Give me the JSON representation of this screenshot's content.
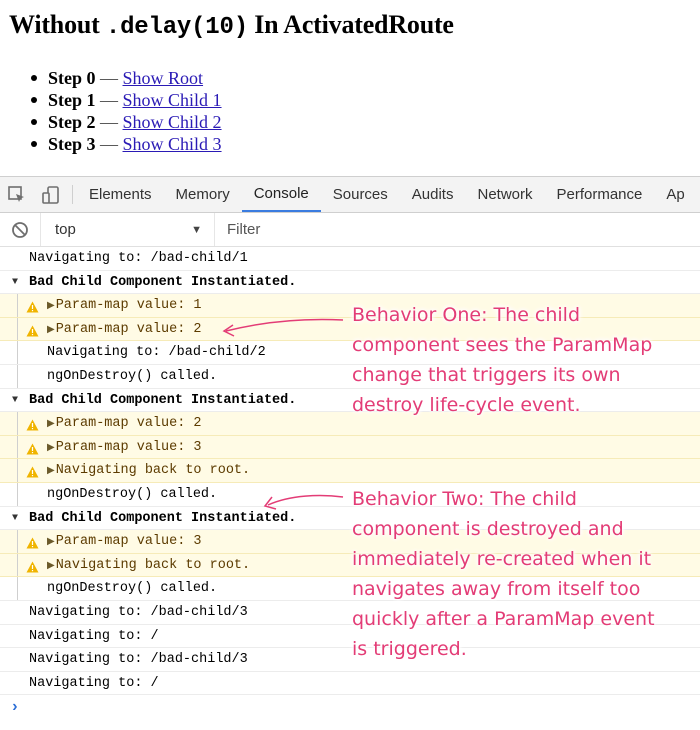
{
  "page": {
    "title_prefix": "Without ",
    "title_code": ".delay(10)",
    "title_suffix": " In ActivatedRoute",
    "steps": [
      {
        "label": "Step 0",
        "dash": " — ",
        "link": "Show Root"
      },
      {
        "label": "Step 1",
        "dash": " — ",
        "link": "Show Child 1"
      },
      {
        "label": "Step 2",
        "dash": " — ",
        "link": "Show Child 2"
      },
      {
        "label": "Step 3",
        "dash": " — ",
        "link": "Show Child 3"
      }
    ]
  },
  "devtools": {
    "tabs": [
      "Elements",
      "Memory",
      "Console",
      "Sources",
      "Audits",
      "Network",
      "Performance",
      "Ap"
    ],
    "active_tab": "Console",
    "context": "top",
    "filter_placeholder": "Filter",
    "accent_color": "#3a7ce0"
  },
  "console": {
    "lines": [
      {
        "type": "log",
        "text": "Navigating to: /bad-child/1"
      },
      {
        "type": "group",
        "text": "Bad Child Component Instantiated."
      },
      {
        "type": "warn",
        "text": "Param-map value: 1"
      },
      {
        "type": "warn",
        "text": "Param-map value: 2"
      },
      {
        "type": "child",
        "text": "Navigating to: /bad-child/2"
      },
      {
        "type": "child",
        "text": "ngOnDestroy() called."
      },
      {
        "type": "group",
        "text": "Bad Child Component Instantiated."
      },
      {
        "type": "warn",
        "text": "Param-map value: 2"
      },
      {
        "type": "warn",
        "text": "Param-map value: 3"
      },
      {
        "type": "warn",
        "text": "Navigating back to root."
      },
      {
        "type": "child",
        "text": "ngOnDestroy() called."
      },
      {
        "type": "group",
        "text": "Bad Child Component Instantiated."
      },
      {
        "type": "warn",
        "text": "Param-map value: 3"
      },
      {
        "type": "warn",
        "text": "Navigating back to root."
      },
      {
        "type": "child",
        "text": "ngOnDestroy() called."
      },
      {
        "type": "log",
        "text": "Navigating to: /bad-child/3"
      },
      {
        "type": "log",
        "text": "Navigating to: /"
      },
      {
        "type": "log",
        "text": "Navigating to: /bad-child/3"
      },
      {
        "type": "log",
        "text": "Navigating to: /"
      }
    ]
  },
  "annotations": {
    "one": {
      "label": "Behavior One:",
      "lines": [
        " The child",
        "component sees the ParamMap",
        "change that triggers its own",
        "destroy life-cycle event."
      ]
    },
    "two": {
      "label": "Behavior Two:",
      "lines": [
        " The child",
        "component is destroyed and",
        "immediately re-created when it",
        "navigates away from itself too",
        "quickly after a ParamMap event",
        "is triggered."
      ]
    },
    "color": "#e33c76"
  }
}
